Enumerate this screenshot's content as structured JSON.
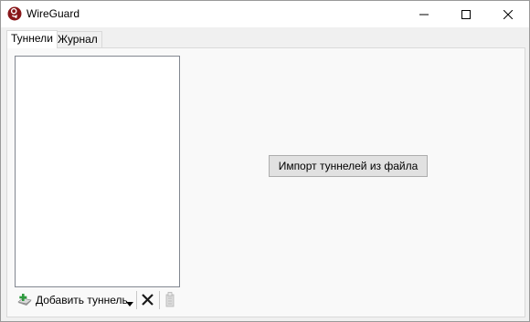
{
  "window": {
    "title": "WireGuard",
    "app_icon": "wireguard-logo-icon",
    "controls": [
      "minimize-icon",
      "maximize-icon",
      "close-icon"
    ]
  },
  "tabs": [
    {
      "label": "Туннели",
      "active": true
    },
    {
      "label": "Журнал",
      "active": false
    }
  ],
  "tunnels_page": {
    "tunnel_list": [],
    "toolbar": {
      "add_label": "Добавить туннель",
      "add_icon": "add-tunnel-icon",
      "dropdown_icon": "chevron-down-icon",
      "delete_icon": "delete-icon",
      "export_icon": "export-icon"
    },
    "import_button_label": "Импорт туннелей из файла"
  },
  "colors": {
    "brand": "#88171a",
    "add_icon_green": "#2e9a3e"
  }
}
